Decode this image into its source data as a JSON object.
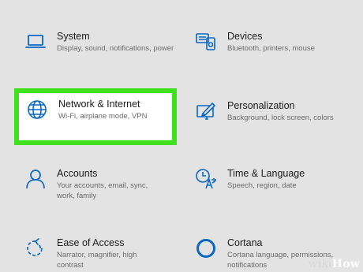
{
  "accent_color": "#0a67c4",
  "highlight_color": "#3ee11c",
  "tiles": [
    {
      "title": "System",
      "desc": "Display, sound, notifications, power",
      "icon": "laptop-icon"
    },
    {
      "title": "Devices",
      "desc": "Bluetooth, printers, mouse",
      "icon": "devices-icon"
    },
    {
      "title": "Network & Internet",
      "desc": "Wi-Fi, airplane mode, VPN",
      "icon": "globe-icon"
    },
    {
      "title": "Personalization",
      "desc": "Background, lock screen, colors",
      "icon": "paint-icon"
    },
    {
      "title": "Accounts",
      "desc": "Your accounts, email, sync, work, family",
      "icon": "person-icon"
    },
    {
      "title": "Time & Language",
      "desc": "Speech, region, date",
      "icon": "time-language-icon"
    },
    {
      "title": "Ease of Access",
      "desc": "Narrator, magnifier, high contrast",
      "icon": "ease-of-access-icon"
    },
    {
      "title": "Cortana",
      "desc": "Cortana language, permissions, notifications",
      "icon": "cortana-icon"
    }
  ],
  "watermark": {
    "left": "wiki",
    "right": "How"
  }
}
